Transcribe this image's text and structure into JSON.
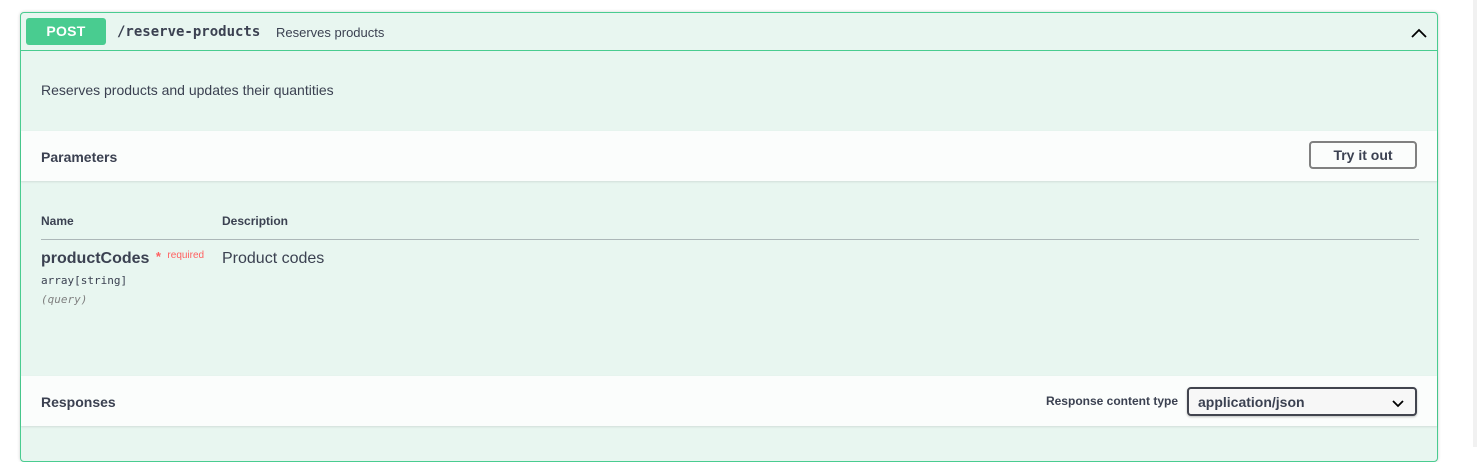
{
  "operation": {
    "method": "POST",
    "path": "/reserve-products",
    "summary": "Reserves products",
    "description": "Reserves products and updates their quantities",
    "collapse_icon": "chevron-up-icon"
  },
  "parameters": {
    "title": "Parameters",
    "try_button": "Try it out",
    "columns": {
      "name": "Name",
      "description": "Description"
    },
    "items": [
      {
        "name": "productCodes",
        "required_mark": "*",
        "required_label": "required",
        "type": "array[string]",
        "in": "(query)",
        "description": "Product codes"
      }
    ]
  },
  "responses": {
    "title": "Responses",
    "content_type_label": "Response content type",
    "content_type_value": "application/json",
    "dropdown_icon": "chevron-down-icon"
  },
  "colors": {
    "method_post": "#49cc90",
    "block_bg": "#e8f6f0",
    "text": "#3b4151",
    "required": "#ff6060"
  }
}
